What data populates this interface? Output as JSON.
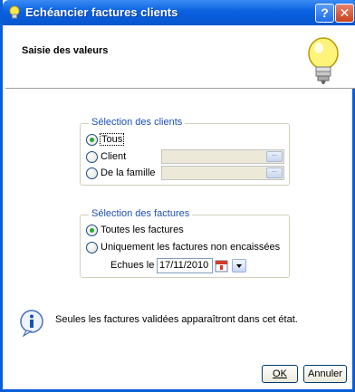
{
  "window": {
    "title": "Echéancier factures clients",
    "help_button": "?",
    "close_button": "✕"
  },
  "header": {
    "title": "Saisie des valeurs"
  },
  "clients_group": {
    "legend": "Sélection des clients",
    "options": [
      {
        "label": "Tous",
        "checked": true
      },
      {
        "label": "Client",
        "checked": false
      },
      {
        "label": "De la famille",
        "checked": false
      }
    ],
    "picker_button_label": "..."
  },
  "factures_group": {
    "legend": "Sélection des factures",
    "options": [
      {
        "label": "Toutes les factures",
        "checked": true
      },
      {
        "label": "Uniquement les factures non encaissées",
        "checked": false
      }
    ],
    "due_label": "Echues le",
    "due_date": "17/11/2010"
  },
  "info": {
    "text": "Seules les factures validées apparaîtront dans cet état."
  },
  "buttons": {
    "ok": "OK",
    "cancel": "Annuler"
  },
  "colors": {
    "titlebar": "#0a61e0",
    "legend_text": "#1e4fb5",
    "radio_dot": "#2fa62f"
  }
}
